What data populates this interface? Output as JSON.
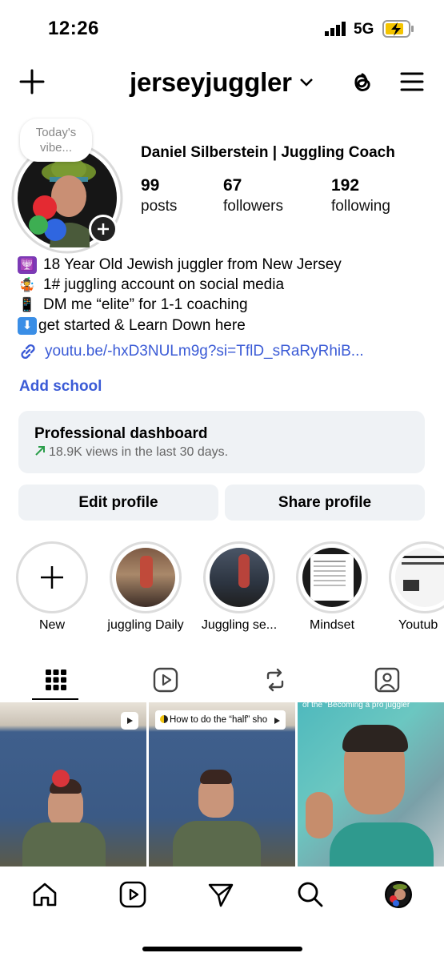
{
  "status_bar": {
    "time": "12:26",
    "network": "5G"
  },
  "header": {
    "username": "jerseyjuggler"
  },
  "profile": {
    "note": "Today's vibe...",
    "display_name": "Daniel Silberstein | Juggling Coach",
    "stats": [
      {
        "value": "99",
        "label": "posts"
      },
      {
        "value": "67",
        "label": "followers"
      },
      {
        "value": "192",
        "label": "following"
      }
    ],
    "bio": [
      {
        "icon": "menorah-emoji",
        "text": "18 Year Old Jewish juggler from New Jersey"
      },
      {
        "icon": "juggler-emoji",
        "text": "1# juggling account on social media"
      },
      {
        "icon": "phone-emoji",
        "text": "DM me “elite” for 1-1 coaching"
      },
      {
        "icon": "down-arrow-emoji",
        "text": "get started & Learn Down here"
      }
    ],
    "link": "youtu.be/-hxD3NULm9g?si=TflD_sRaRyRhiB...",
    "add_school": "Add school"
  },
  "dashboard": {
    "title": "Professional dashboard",
    "subtitle": "18.9K views in the last 30 days."
  },
  "buttons": {
    "edit": "Edit profile",
    "share": "Share profile"
  },
  "highlights": [
    {
      "label": "New"
    },
    {
      "label": "juggling Daily"
    },
    {
      "label": "Juggling se..."
    },
    {
      "label": "Mindset"
    },
    {
      "label": "Youtub"
    }
  ],
  "posts": [
    {
      "caption": ""
    },
    {
      "caption": "How to do the “half” sho"
    },
    {
      "caption": "of the \"Becoming a pro juggler"
    }
  ],
  "colors": {
    "link": "#3b5bd6",
    "button_bg": "#eff2f5",
    "accent_green": "#2a9d4a"
  }
}
